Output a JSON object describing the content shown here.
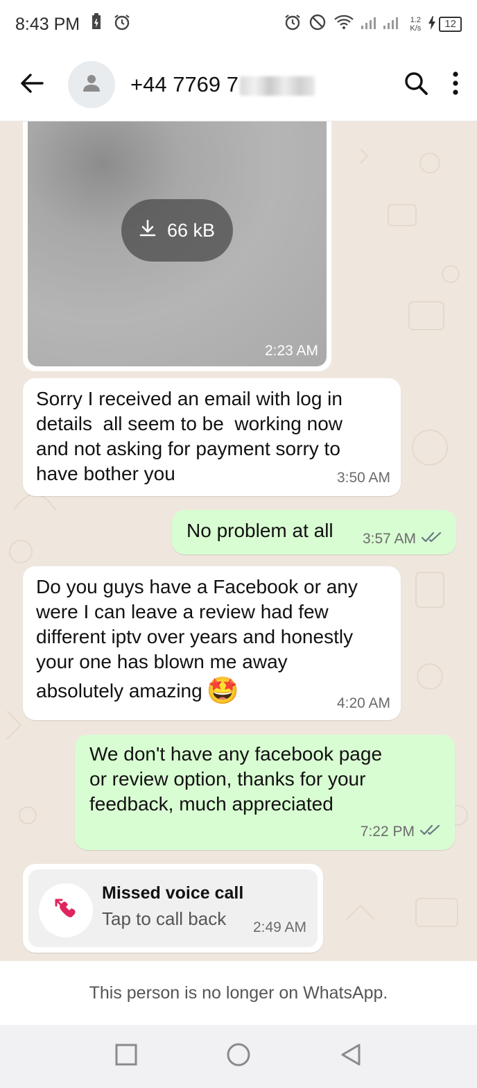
{
  "status_bar": {
    "time": "8:43 PM",
    "net_speed_value": "1.2",
    "net_speed_unit": "K/s",
    "battery": "12"
  },
  "header": {
    "contact_number": "+44 7769 7",
    "icons": [
      "back-arrow-icon",
      "avatar-icon",
      "search-icon",
      "more-vert-icon"
    ]
  },
  "messages": [
    {
      "type": "image",
      "direction": "incoming",
      "size": "66 kB",
      "time": "2:23 AM"
    },
    {
      "type": "text",
      "direction": "incoming",
      "lines": [
        "Sorry I received an email with log in",
        "details  all seem to be  working now",
        "and not asking for payment sorry to",
        "have bother you"
      ],
      "time": "3:50 AM"
    },
    {
      "type": "text",
      "direction": "outgoing",
      "lines": [
        "No problem at all"
      ],
      "time": "3:57 AM"
    },
    {
      "type": "text",
      "direction": "incoming",
      "lines": [
        "Do you guys have a Facebook or any",
        "were I can leave a review had few",
        "different iptv over years and honestly",
        "your one has blown me away",
        "absolutely amazing"
      ],
      "emoji": "🤩",
      "time": "4:20 AM"
    },
    {
      "type": "text",
      "direction": "outgoing",
      "lines": [
        "We don't have any facebook page",
        "or review option, thanks for your",
        "feedback, much appreciated"
      ],
      "time": "7:22 PM"
    },
    {
      "type": "missed_call",
      "direction": "incoming",
      "title": "Missed voice call",
      "subtitle": "Tap to call back",
      "time": "2:49 AM"
    }
  ],
  "footer": {
    "notice": "This person is no longer on WhatsApp."
  },
  "colors": {
    "outgoing_bubble": "#d9fdd3",
    "incoming_bubble": "#ffffff",
    "chat_background": "#efe7de",
    "missed_call_red": "#e0245e"
  }
}
